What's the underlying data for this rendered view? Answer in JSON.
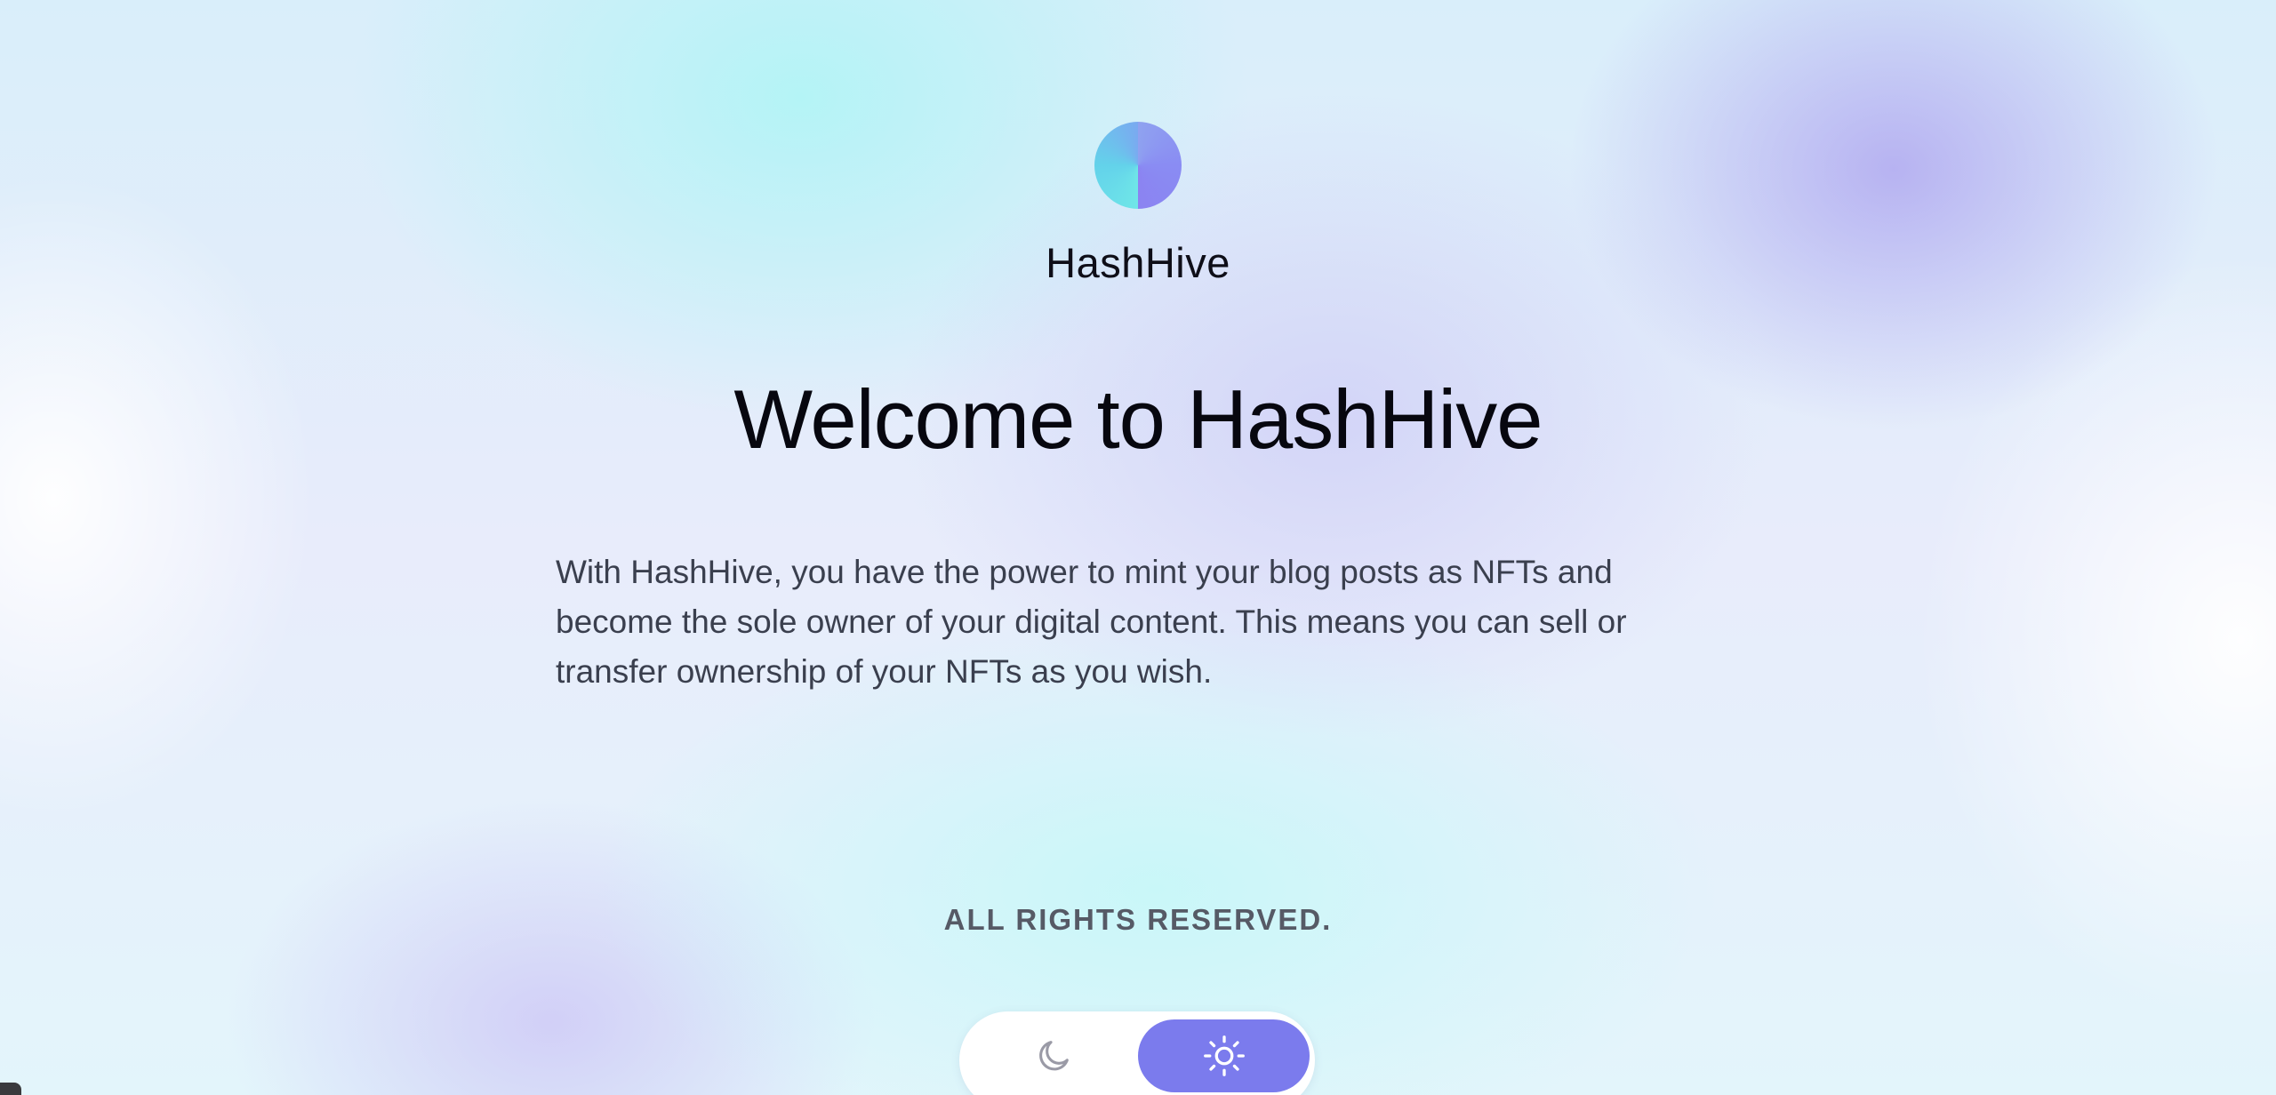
{
  "brand": {
    "name": "HashHive"
  },
  "hero": {
    "title": "Welcome to HashHive",
    "description": "With HashHive, you have the power to mint your blog posts as NFTs and become the sole owner of your digital content. This means you can sell or transfer ownership of your NFTs as you wish."
  },
  "footer": {
    "rights": "ALL RIGHTS RESERVED."
  },
  "theme_toggle": {
    "options": [
      {
        "name": "dark",
        "icon": "moon-icon"
      },
      {
        "name": "light",
        "icon": "sun-icon"
      }
    ],
    "selected": "light",
    "active_color": "#7b7bed",
    "inactive_icon_color": "#9a9aa6"
  },
  "colors": {
    "accent": "#7b7bed",
    "logo_cyan": "#6fe6e8",
    "logo_violet": "#8b83f1"
  }
}
